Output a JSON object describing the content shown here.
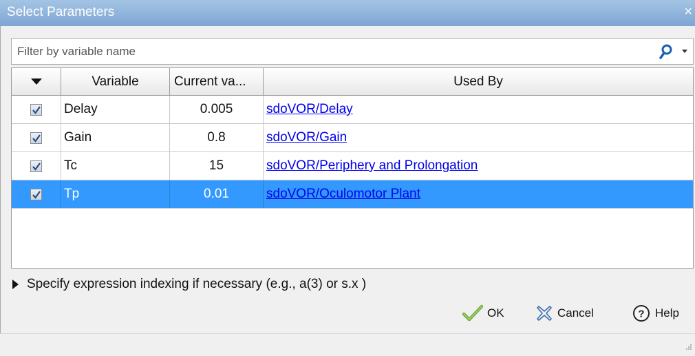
{
  "window": {
    "title": "Select Parameters",
    "close_glyph": "×"
  },
  "filter": {
    "placeholder": "Filter by variable name",
    "value": ""
  },
  "table": {
    "columns": [
      "",
      "Variable",
      "Current va...",
      "Used By"
    ],
    "rows": [
      {
        "checked": true,
        "variable": "Delay",
        "value": "0.005",
        "used_by": "sdoVOR/Delay",
        "selected": false
      },
      {
        "checked": true,
        "variable": "Gain",
        "value": "0.8",
        "used_by": "sdoVOR/Gain",
        "selected": false
      },
      {
        "checked": true,
        "variable": "Tc",
        "value": "15",
        "used_by": "sdoVOR/Periphery and Prolongation",
        "selected": false
      },
      {
        "checked": true,
        "variable": "Tp",
        "value": "0.01",
        "used_by": "sdoVOR/Oculomotor Plant",
        "selected": true
      }
    ]
  },
  "expander": {
    "label": "Specify expression indexing if necessary (e.g., a(3) or s.x )"
  },
  "buttons": {
    "ok": "OK",
    "cancel": "Cancel",
    "help": "Help"
  },
  "icons": {
    "search": "search-icon",
    "ok": "checkmark-icon",
    "cancel": "cancel-x-icon",
    "help": "help-question-icon"
  },
  "colors": {
    "selection": "#3399ff",
    "link": "#0000ee",
    "titlebar": "#8cb2da"
  }
}
